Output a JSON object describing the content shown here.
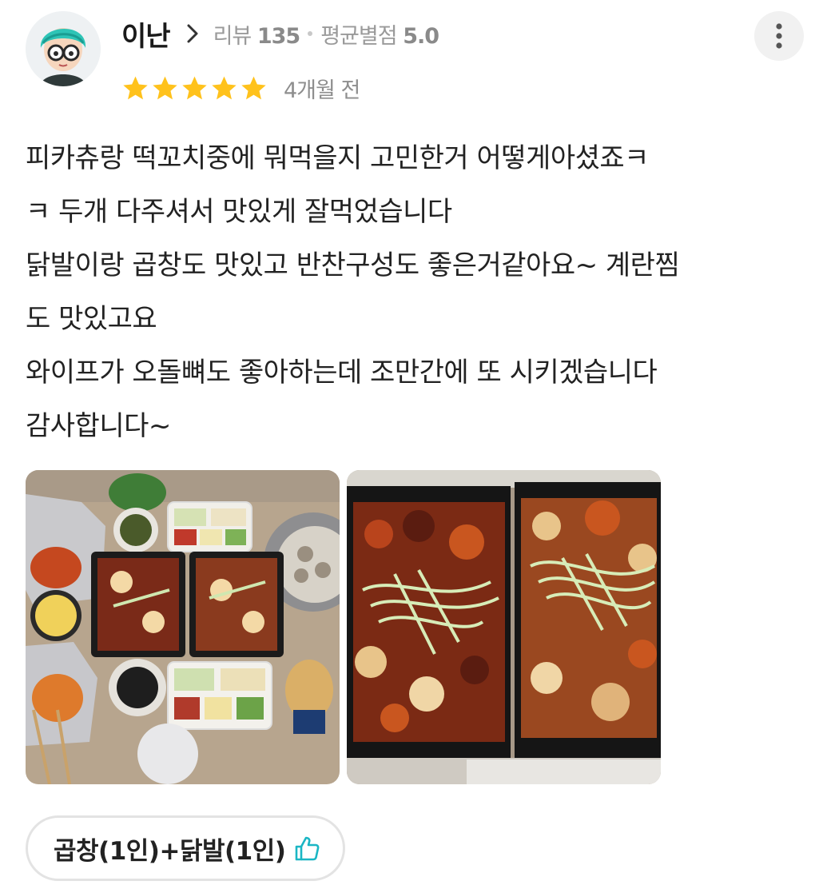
{
  "author": {
    "name": "이난",
    "reviews_label": "리뷰",
    "reviews_count": "135",
    "avg_label": "평균별점",
    "avg_value": "5.0",
    "avatar_icon": "cartoon-avatar-icon"
  },
  "rating": {
    "stars": 5,
    "max": 5,
    "color": "#ffc21c"
  },
  "time_ago": "4개월 전",
  "review_lines": [
    "피카츄랑 떡꼬치중에 뭐먹을지 고민한거 어떻게아셨죠ㅋ",
    "ㅋ 두개 다주셔서 맛있게 잘먹었습니다",
    "닭발이랑 곱창도 맛있고 반찬구성도 좋은거같아요~ 계란찜",
    "도 맛있고요",
    "와이프가 오돌뼈도 좋아하는데 조만간에 또 시키겠습니다",
    "감사합니다~"
  ],
  "photos": [
    {
      "icon": "food-photo-overview"
    },
    {
      "icon": "food-photo-closeup"
    }
  ],
  "menu_tag": {
    "label": "곱창(1인)+닭발(1인)",
    "icon": "thumbs-up-icon",
    "icon_color": "#1bb6c4"
  },
  "colors": {
    "star": "#ffc21c",
    "meta_gray": "#9a9a9a",
    "accent": "#1bb6c4"
  }
}
